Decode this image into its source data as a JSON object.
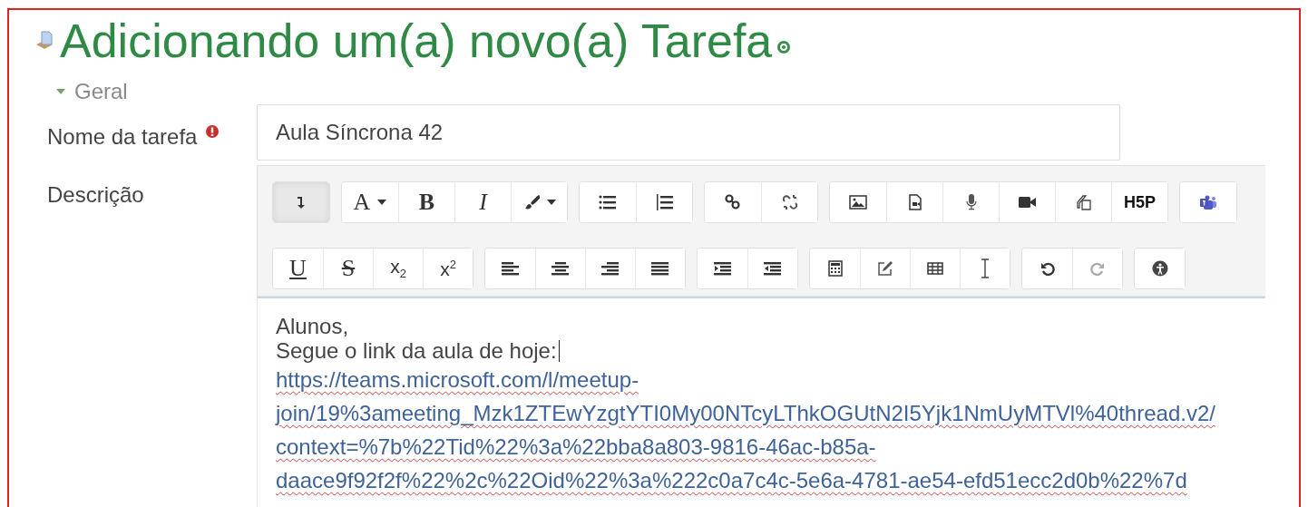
{
  "page_title": "Adicionando um(a) novo(a) Tarefa",
  "section": {
    "label": "Geral",
    "expanded": true
  },
  "fields": [
    {
      "kind": "text",
      "label": "Nome da tarefa",
      "required": true,
      "value": "Aula Síncrona 42"
    },
    {
      "kind": "editor",
      "label": "Descrição",
      "required": false
    }
  ],
  "toolbar_rows": [
    [
      [
        {
          "kind": "collapse",
          "pressed": true
        }
      ],
      [
        {
          "kind": "letter",
          "label": "A",
          "dropdown": true
        },
        {
          "kind": "bold",
          "label": "B"
        },
        {
          "kind": "italic",
          "label": "I"
        },
        {
          "kind": "brush",
          "dropdown": true
        }
      ],
      [
        {
          "kind": "bullets"
        },
        {
          "kind": "numbers"
        }
      ],
      [
        {
          "kind": "link"
        },
        {
          "kind": "unlink"
        }
      ],
      [
        {
          "kind": "image"
        },
        {
          "kind": "media"
        },
        {
          "kind": "mic"
        },
        {
          "kind": "video"
        },
        {
          "kind": "files"
        },
        {
          "kind": "logo",
          "label": "H5P"
        }
      ],
      [
        {
          "kind": "teams"
        }
      ]
    ],
    [
      [
        {
          "kind": "underline",
          "label": "U"
        },
        {
          "kind": "strike",
          "label": "S"
        },
        {
          "kind": "plain",
          "label": "x$_{2}$"
        },
        {
          "kind": "plain",
          "label": "x$^{2}$"
        }
      ],
      [
        {
          "kind": "align-left"
        },
        {
          "kind": "align-center"
        },
        {
          "kind": "align-right"
        },
        {
          "kind": "justify"
        }
      ],
      [
        {
          "kind": "outdent"
        },
        {
          "kind": "indent"
        }
      ],
      [
        {
          "kind": "calculator"
        },
        {
          "kind": "edit"
        },
        {
          "kind": "table"
        },
        {
          "kind": "ibeam"
        }
      ],
      [
        {
          "kind": "undo"
        },
        {
          "kind": "redo",
          "disabled": true
        }
      ],
      [
        {
          "kind": "accessibility"
        }
      ]
    ]
  ],
  "editor_lines": [
    {
      "kind": "text",
      "text": "Alunos,"
    },
    {
      "kind": "text",
      "text": "Segue o link da aula de hoje:",
      "caret": true
    },
    {
      "kind": "link",
      "text": "https://teams.microsoft.com/l/meetup-"
    },
    {
      "kind": "link",
      "text": "join/19%3ameeting_Mzk1ZTEwYzgtYTI0My00NTcyLThkOGUtN2I5Yjk1NmUyMTVl%40thread.v2/"
    },
    {
      "kind": "link",
      "text": "context=%7b%22Tid%22%3a%22bba8a803-9816-46ac-b85a-"
    },
    {
      "kind": "link",
      "text": "daace9f92f2f%22%2c%22Oid%22%3a%222c0a7c4c-5e6a-4781-ae54-efd51ecc2d0b%22%7d"
    }
  ]
}
